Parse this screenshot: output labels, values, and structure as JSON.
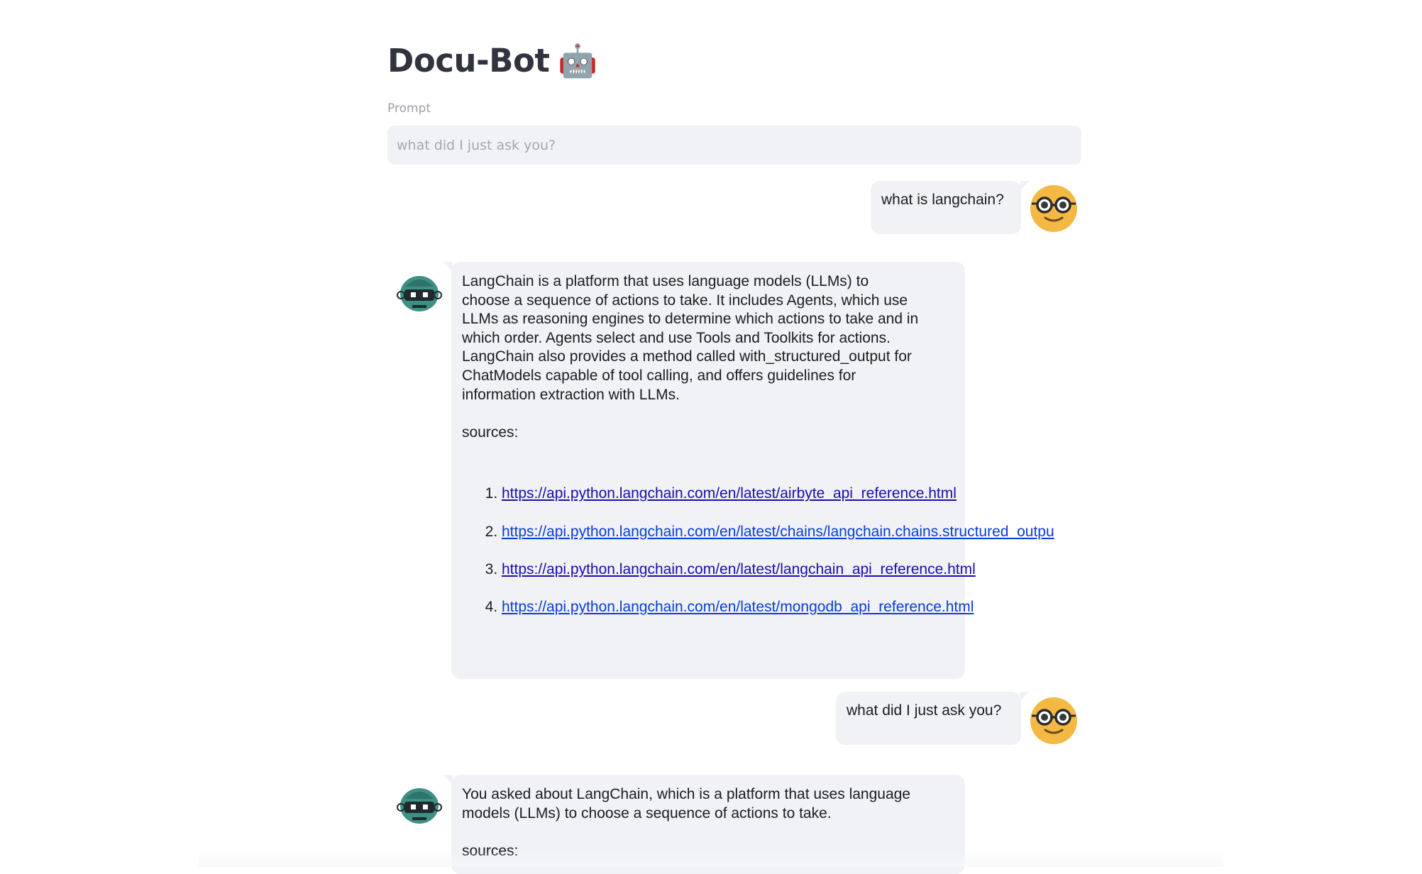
{
  "app": {
    "title": "Docu-Bot",
    "title_emoji": "🤖"
  },
  "prompt": {
    "label": "Prompt",
    "placeholder": "what did I just ask you?"
  },
  "messages": [
    {
      "role": "user",
      "avatar_icon": "nerd-face-icon",
      "text": "what is langchain?"
    },
    {
      "role": "assistant",
      "avatar_icon": "robot-avatar-icon",
      "text": "LangChain is a platform that uses language models (LLMs) to\nchoose a sequence of actions to take. It includes Agents, which use\nLLMs as reasoning engines to determine which actions to take and in\nwhich order. Agents select and use Tools and Toolkits for actions.\nLangChain also provides a method called with_structured_output for\nChatModels capable of tool calling, and offers guidelines for\ninformation extraction with LLMs.",
      "sources_label": "sources:",
      "sources": [
        "https://api.python.langchain.com/en/latest/airbyte_api_reference.html",
        "https://api.python.langchain.com/en/latest/chains/langchain.chains.structured_outpu",
        "https://api.python.langchain.com/en/latest/langchain_api_reference.html",
        "https://api.python.langchain.com/en/latest/mongodb_api_reference.html"
      ]
    },
    {
      "role": "user",
      "avatar_icon": "nerd-face-icon",
      "text": "what did I just ask you?"
    },
    {
      "role": "assistant",
      "avatar_icon": "robot-avatar-icon",
      "text": "You asked about LangChain, which is a platform that uses language\nmodels (LLMs) to choose a sequence of actions to take.",
      "sources_label": "sources:"
    }
  ],
  "colors": {
    "bubble_bg": "#f0f2f6",
    "input_bg": "#f0f2f6",
    "link_visited": "#1a0dab",
    "link": "#0b3bd8",
    "user_avatar": "#f4b942",
    "bot_avatar": "#3e8f84"
  }
}
